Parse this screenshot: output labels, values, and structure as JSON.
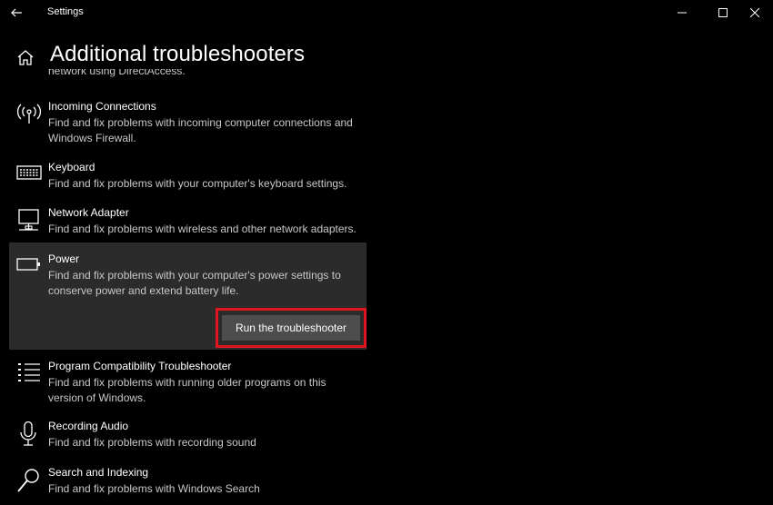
{
  "window": {
    "app_title": "Settings"
  },
  "page": {
    "title": "Additional troubleshooters"
  },
  "clipped_item_tail": "network using DirectAccess.",
  "troubleshooters": [
    {
      "name": "Incoming Connections",
      "desc": "Find and fix problems with incoming computer connections and Windows Firewall.",
      "icon": "antenna-icon"
    },
    {
      "name": "Keyboard",
      "desc": "Find and fix problems with your computer's keyboard settings.",
      "icon": "keyboard-icon"
    },
    {
      "name": "Network Adapter",
      "desc": "Find and fix problems with wireless and other network adapters.",
      "icon": "monitor-network-icon"
    },
    {
      "name": "Power",
      "desc": "Find and fix problems with your computer's power settings to conserve power and extend battery life.",
      "icon": "battery-icon",
      "selected": true
    },
    {
      "name": "Program Compatibility Troubleshooter",
      "desc": "Find and fix problems with running older programs on this version of Windows.",
      "icon": "list-icon"
    },
    {
      "name": "Recording Audio",
      "desc": "Find and fix problems with recording sound",
      "icon": "microphone-icon"
    },
    {
      "name": "Search and Indexing",
      "desc": "Find and fix problems with Windows Search",
      "icon": "search-icon"
    }
  ],
  "run_button_label": "Run the troubleshooter",
  "colors": {
    "background": "#000000",
    "selected_bg": "#2b2b2b",
    "highlight": "#e0141e",
    "button": "#4d4d4d"
  }
}
